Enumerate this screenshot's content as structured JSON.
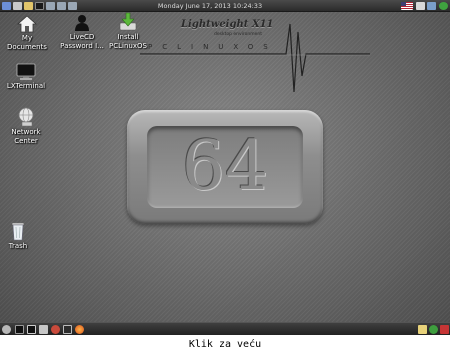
{
  "top_panel": {
    "clock": "Monday June 17, 2013 10:24:33"
  },
  "desktop": {
    "icons": [
      {
        "label_line1": "My",
        "label_line2": "Documents"
      },
      {
        "label_line1": "LiveCD",
        "label_line2": "Password I..."
      },
      {
        "label_line1": "Install",
        "label_line2": "PCLinuxOS"
      },
      {
        "label_line1": "LXTerminal",
        "label_line2": ""
      },
      {
        "label_line1": "Network",
        "label_line2": "Center"
      },
      {
        "label_line1": "Trash",
        "label_line2": ""
      }
    ]
  },
  "wallpaper": {
    "brand_title": "Lightweight X11",
    "brand_subtitle": "desktop environment",
    "brand_word": "PCLINUXOS",
    "plaque_number": "64"
  },
  "caption": "Klik za veću",
  "colors": {
    "panel": "#2b2b2b",
    "desktop": "#6f6f6f",
    "install_icon": "#5cb83c",
    "flag_us": "#b22234"
  }
}
